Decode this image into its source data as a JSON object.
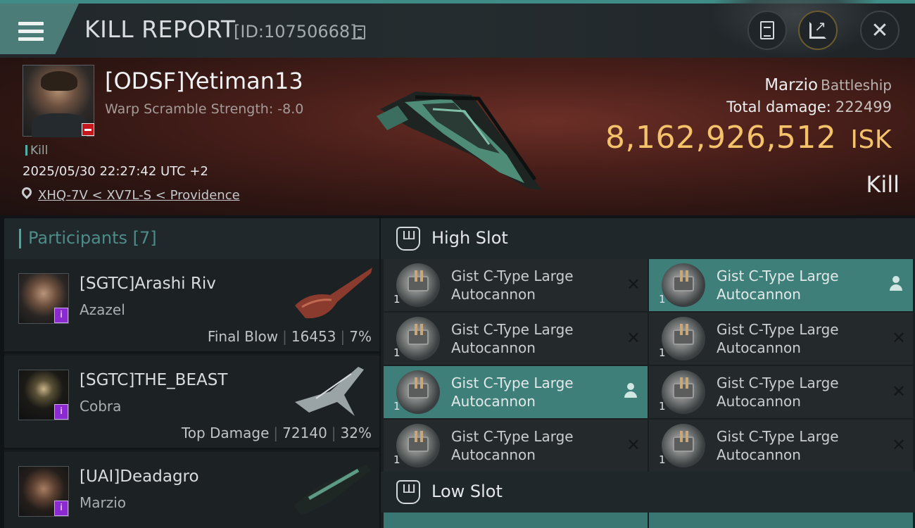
{
  "header": {
    "title": "KILL REPORT",
    "report_id": "[ID:10750668]",
    "colors": {
      "accent": "#3f8c86",
      "isk": "#f4c26b",
      "highlight": "#3e7f7a"
    },
    "icons": [
      "menu-icon",
      "copy-icon",
      "notes-icon",
      "share-icon",
      "close-icon"
    ]
  },
  "victim": {
    "name": "[ODSF]Yetiman13",
    "subtitle": "Warp Scramble Strength: -8.0",
    "tag": "Kill",
    "datetime": "2025/05/30 22:27:42 UTC +2",
    "location": "XHQ-7V < XV7L-S < Providence",
    "ship_name": "Marzio",
    "ship_class": "Battleship",
    "total_damage_label": "Total damage:",
    "total_damage": "222499",
    "isk_value": "8,162,926,512",
    "isk_unit": "ISK",
    "result": "Kill"
  },
  "participants": {
    "title": "Participants",
    "count": "[7]",
    "rows": [
      {
        "name": "[SGTC]Arashi Riv",
        "ship": "Azazel",
        "role": "Final Blow",
        "damage": "16453",
        "percent": "7%",
        "badge": "i"
      },
      {
        "name": "[SGTC]THE_BEAST",
        "ship": "Cobra",
        "role": "Top Damage",
        "damage": "72140",
        "percent": "32%",
        "badge": "i"
      },
      {
        "name": "[UAI]Deadagro",
        "ship": "Marzio",
        "role": "",
        "damage": "",
        "percent": "",
        "badge": "i"
      }
    ]
  },
  "fitting": {
    "high_slot": {
      "title": "High Slot",
      "modules": [
        {
          "line1": "Gist C-Type Large",
          "line2": "Autocannon",
          "qty": "1",
          "status": "destroyed",
          "highlight": false
        },
        {
          "line1": "Gist C-Type Large",
          "line2": "Autocannon",
          "qty": "1",
          "status": "dropped",
          "highlight": true
        },
        {
          "line1": "Gist C-Type Large",
          "line2": "Autocannon",
          "qty": "1",
          "status": "destroyed",
          "highlight": false
        },
        {
          "line1": "Gist C-Type Large",
          "line2": "Autocannon",
          "qty": "1",
          "status": "destroyed",
          "highlight": false
        },
        {
          "line1": "Gist C-Type Large",
          "line2": "Autocannon",
          "qty": "1",
          "status": "dropped",
          "highlight": true
        },
        {
          "line1": "Gist C-Type Large",
          "line2": "Autocannon",
          "qty": "1",
          "status": "destroyed",
          "highlight": false
        },
        {
          "line1": "Gist C-Type Large",
          "line2": "Autocannon",
          "qty": "1",
          "status": "destroyed",
          "highlight": false
        },
        {
          "line1": "Gist C-Type Large",
          "line2": "Autocannon",
          "qty": "1",
          "status": "destroyed",
          "highlight": false
        }
      ]
    },
    "low_slot": {
      "title": "Low Slot"
    }
  }
}
